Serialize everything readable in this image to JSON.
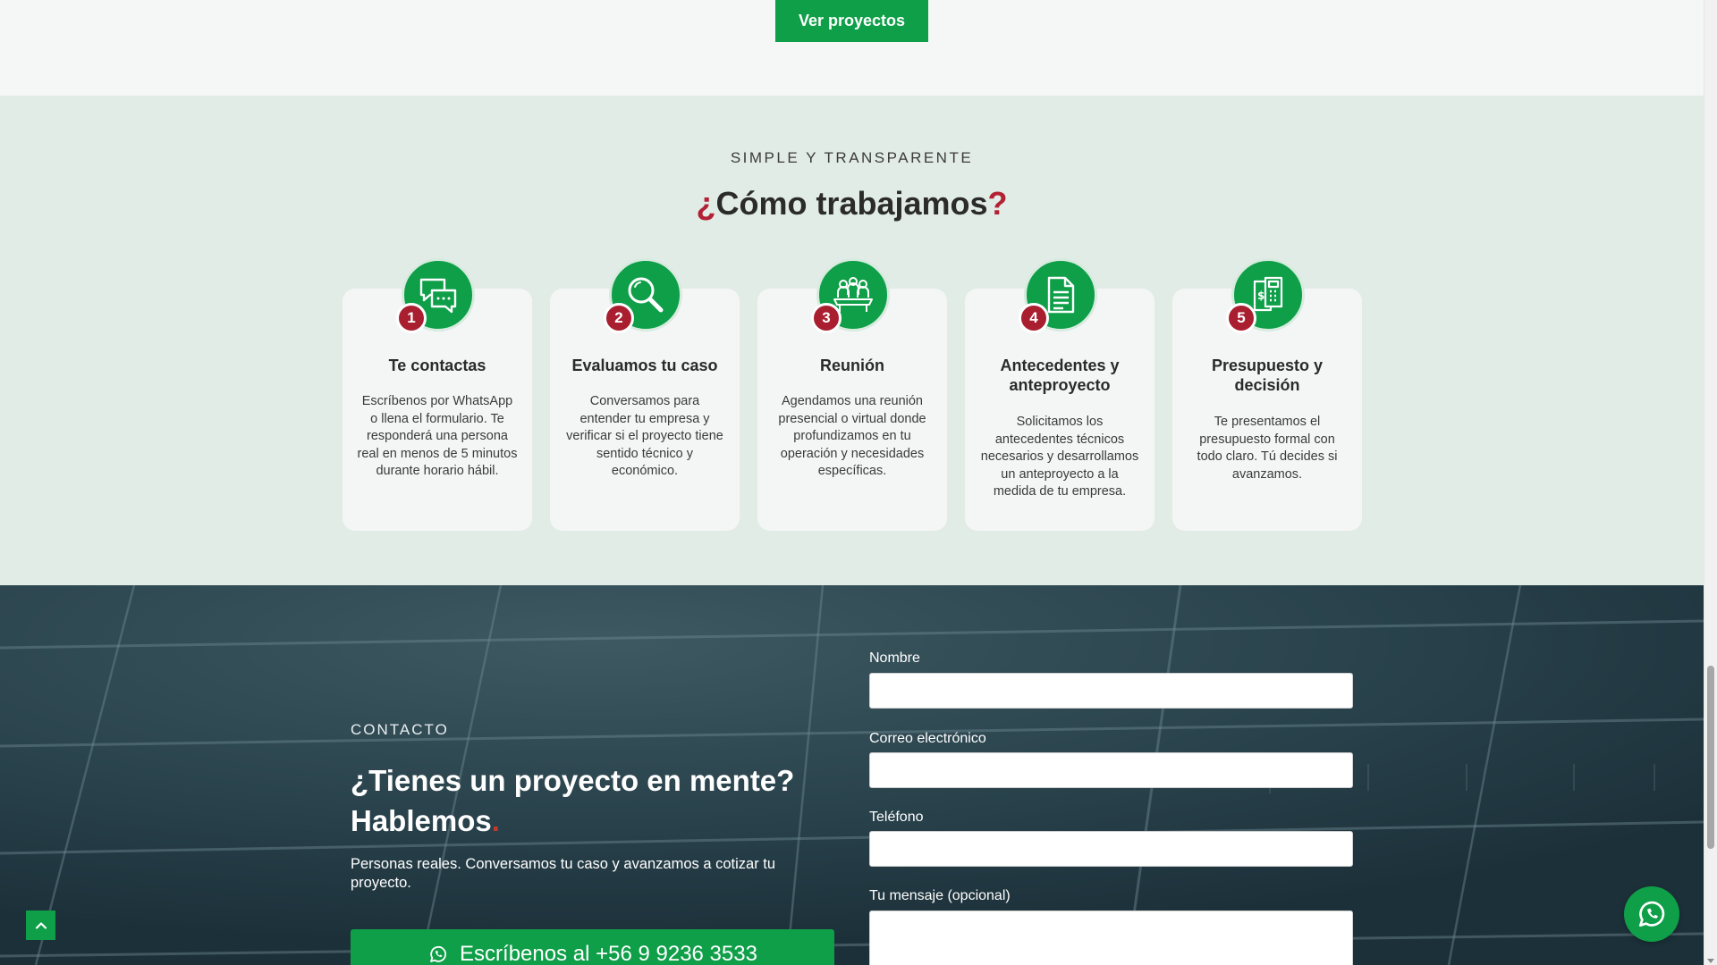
{
  "top": {
    "ver_proyectos": "Ver proyectos"
  },
  "process": {
    "eyebrow": "SIMPLE Y TRANSPARENTE",
    "title_open": "¿",
    "title_text": "Cómo trabajamos",
    "title_close": "?",
    "steps": [
      {
        "num": "1",
        "icon": "chat-bubbles-icon",
        "title": "Te contactas",
        "text": "Escríbenos por WhatsApp o llena el formulario. Te responderá una persona real en menos de 5 minutos durante horario hábil."
      },
      {
        "num": "2",
        "icon": "magnifier-icon",
        "title": "Evaluamos tu caso",
        "text": "Conversamos para entender tu empresa y verificar si el proyecto tiene sentido técnico y económico."
      },
      {
        "num": "3",
        "icon": "meeting-icon",
        "title": "Reunión",
        "text": "Agendamos una reunión presencial o virtual donde profundizamos en tu operación y necesidades específicas."
      },
      {
        "num": "4",
        "icon": "document-icon",
        "title": "Antecedentes y anteproyecto",
        "text": "Solicitamos los antecedentes técnicos necesarios y desarrollamos un anteproyecto a la medida de tu empresa."
      },
      {
        "num": "5",
        "icon": "budget-calculator-icon",
        "title": "Presupuesto y decisión",
        "text": "Te presentamos el presupuesto formal con todo claro. Tú decides si avanzamos."
      }
    ]
  },
  "contact": {
    "eyebrow": "CONTACTO",
    "title": "¿Tienes un proyecto en mente? Hablemos",
    "title_dot": ".",
    "description": "Personas reales. Conversamos tu caso y avanzamos a cotizar tu proyecto.",
    "whatsapp_button": "Escríbenos al +56 9 9236 3533",
    "form": {
      "name_label": "Nombre",
      "email_label": "Correo electrónico",
      "phone_label": "Teléfono",
      "message_label": "Tu mensaje (opcional)"
    }
  },
  "colors": {
    "brand_green": "#0e9f48",
    "accent_red": "#a91f2f",
    "dark_blue": "#233a44",
    "section_bg": "#e2ece6"
  }
}
